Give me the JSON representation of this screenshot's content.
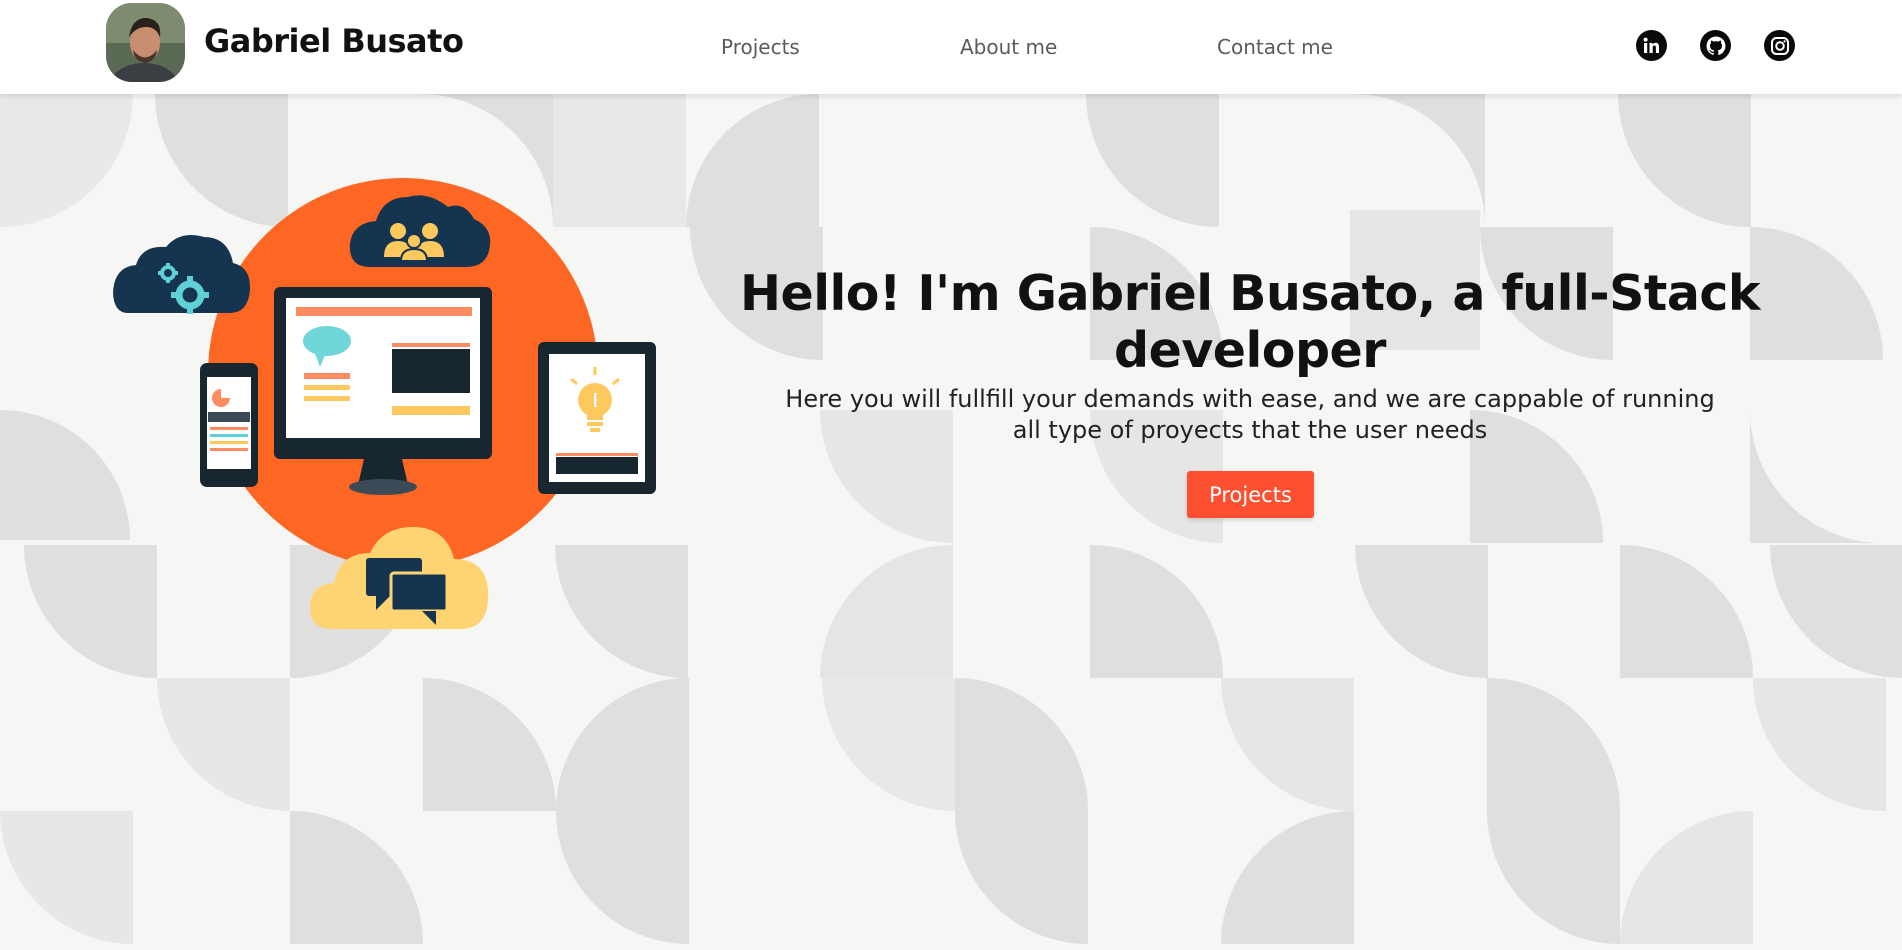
{
  "header": {
    "brand_name": "Gabriel Busato",
    "nav": [
      {
        "label": "Projects"
      },
      {
        "label": "About me"
      },
      {
        "label": "Contact me"
      }
    ],
    "social": [
      {
        "icon": "linkedin-icon"
      },
      {
        "icon": "github-icon"
      },
      {
        "icon": "instagram-icon"
      }
    ]
  },
  "hero": {
    "headline": "Hello! I'm Gabriel Busato, a full-Stack developer",
    "subtext": "Here you will fullfill your demands with ease, and we are cappable of running all type of proyects that the user needs",
    "cta_label": "Projects"
  },
  "colors": {
    "accent": "#fc5030",
    "orange_circle": "#fe6623",
    "navy": "#15344f",
    "yellow": "#fdc95e",
    "teal": "#5fd0d7",
    "pattern_gray": "#dededd"
  }
}
